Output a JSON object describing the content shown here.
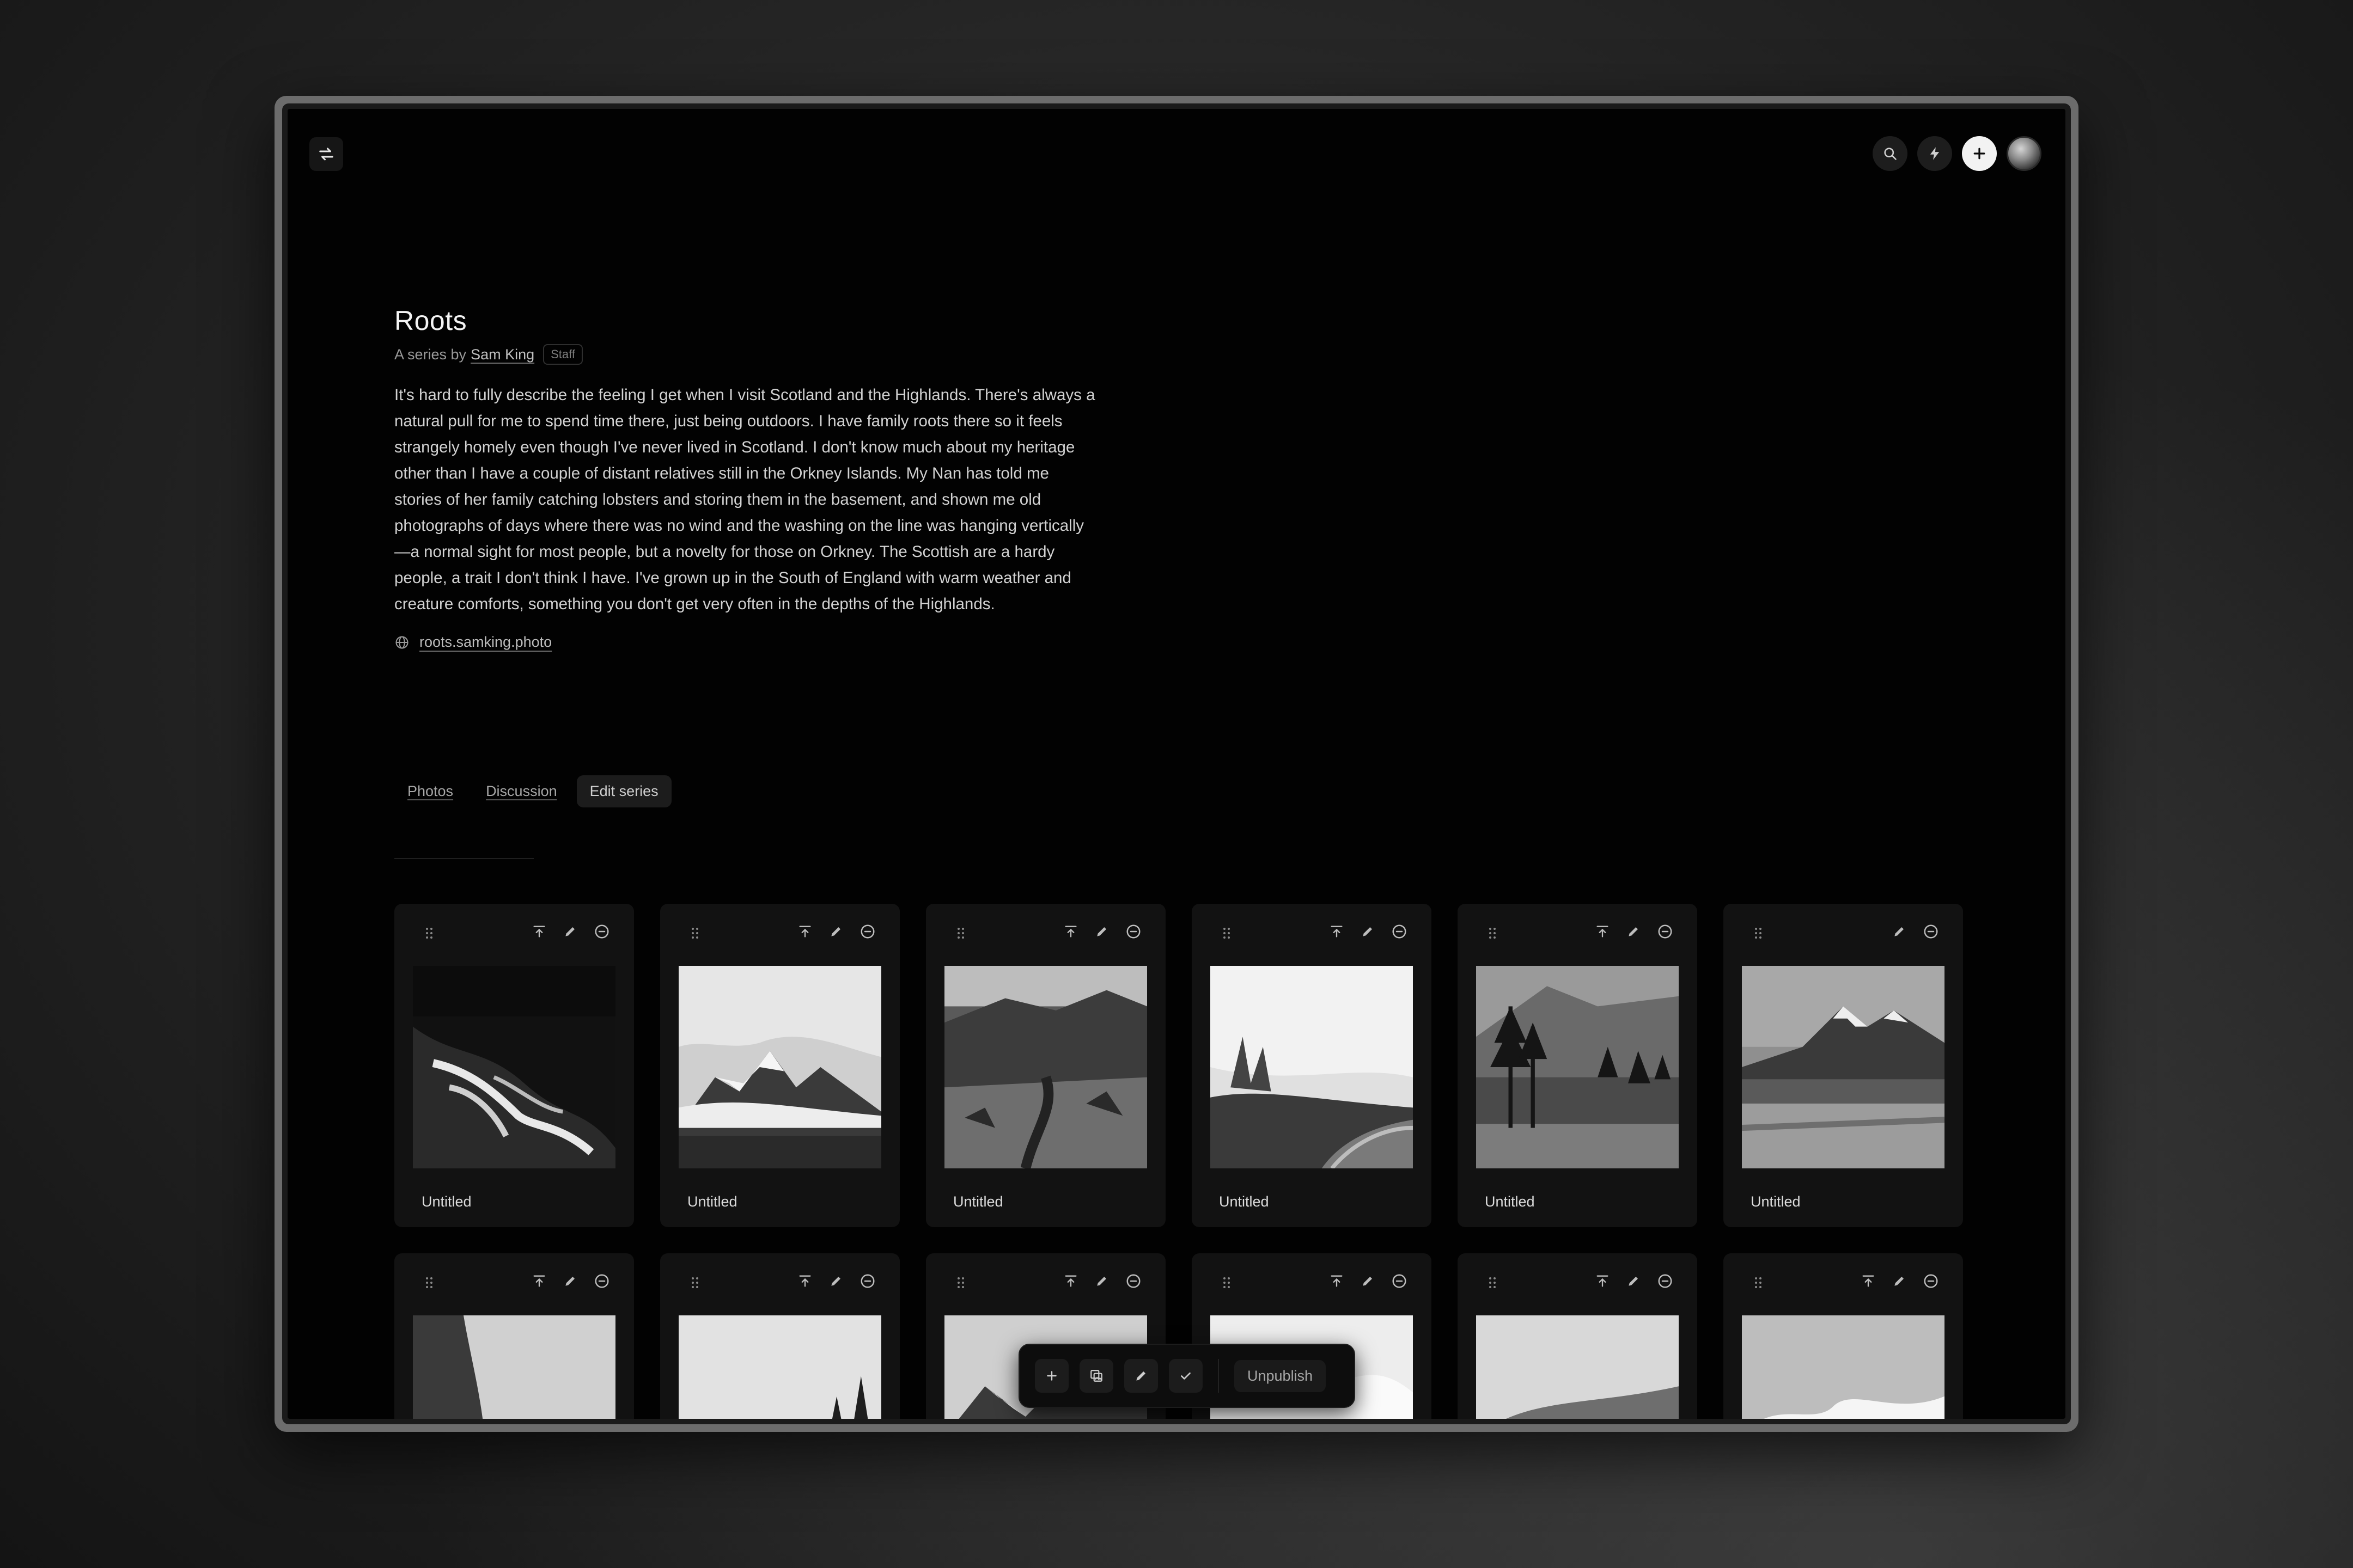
{
  "series": {
    "title": "Roots",
    "byline_prefix": "A series by",
    "author": "Sam King",
    "badge": "Staff",
    "description": "It's hard to fully describe the feeling I get when I visit Scotland and the Highlands. There's always a natural pull for me to spend time there, just being outdoors. I have family roots there so it feels strangely homely even though I've never lived in Scotland. I don't know much about my heritage other than I have a couple of distant relatives still in the Orkney Islands. My Nan has told me stories of her family catching lobsters and storing them in the basement, and shown me old photographs of days where there was no wind and the washing on the line was hanging vertically—a normal sight for most people, but a novelty for those on Orkney. The Scottish are a hardy people, a trait I don't think I have. I've grown up in the South of England with warm weather and creature comforts, something you don't get very often in the depths of the Highlands.",
    "website": "roots.samking.photo"
  },
  "tabs": [
    {
      "label": "Photos"
    },
    {
      "label": "Discussion"
    },
    {
      "label": "Edit series"
    }
  ],
  "active_tab": "Edit series",
  "photos": [
    {
      "title": "Untitled",
      "scene": "waves"
    },
    {
      "title": "Untitled",
      "scene": "snow-peaks"
    },
    {
      "title": "Untitled",
      "scene": "rocky-hillside"
    },
    {
      "title": "Untitled",
      "scene": "misty-pinnacles"
    },
    {
      "title": "Untitled",
      "scene": "pine-trees"
    },
    {
      "title": "Untitled",
      "scene": "mountain-lake"
    },
    {
      "title": "",
      "scene": "cliff-cloud"
    },
    {
      "title": "",
      "scene": "cloudy-forest"
    },
    {
      "title": "",
      "scene": "mountain-dark"
    },
    {
      "title": "",
      "scene": "cloudy-mountain"
    },
    {
      "title": "",
      "scene": "rolling-hills"
    },
    {
      "title": "",
      "scene": "bright-clouds"
    }
  ],
  "action_bar": {
    "unpublish_label": "Unpublish"
  },
  "icons": {
    "logo": "switch-arrows-icon",
    "search": "search-icon",
    "activity": "lightning-icon",
    "create": "plus-icon",
    "website": "globe-icon"
  },
  "colors": {
    "background": "#020202",
    "card": "#121212",
    "text": "#d2d2d2"
  }
}
